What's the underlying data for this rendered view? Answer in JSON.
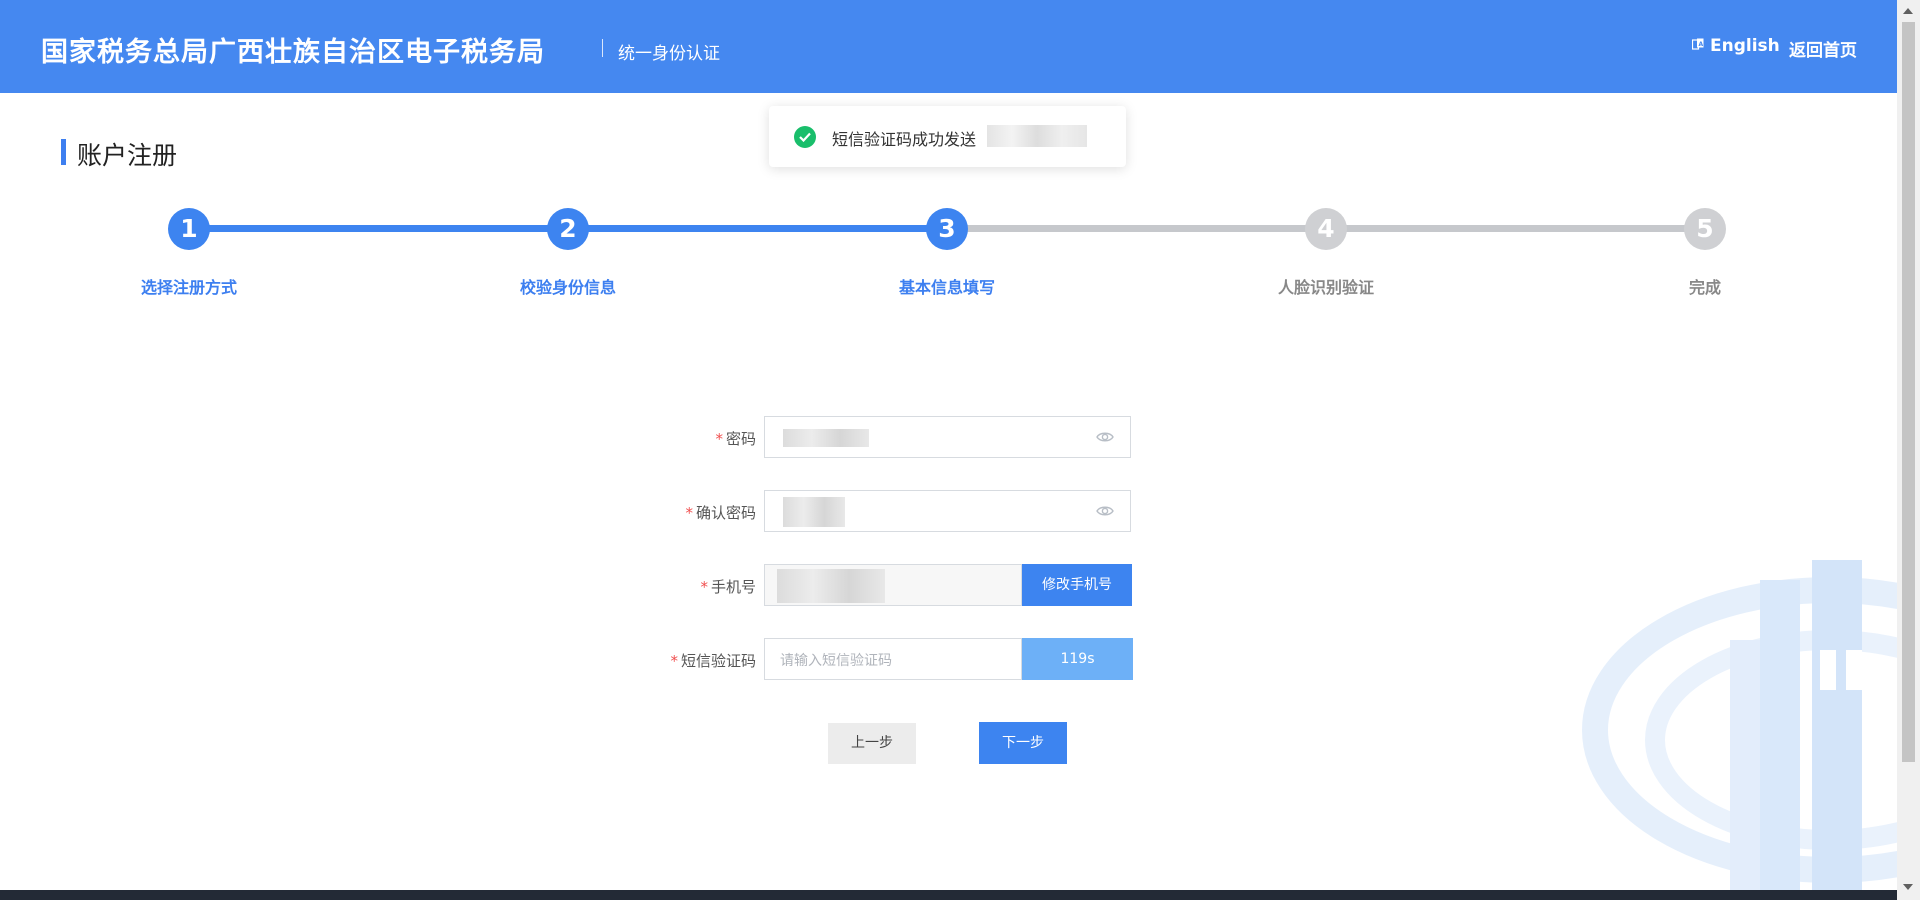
{
  "header": {
    "title": "国家税务总局广西壮族自治区电子税务局",
    "subtitle": "统一身份认证",
    "language_label": "English",
    "home_label": "返回首页"
  },
  "toast": {
    "message": "短信验证码成功发送",
    "icon": "check-circle-icon"
  },
  "page": {
    "section_title": "账户注册"
  },
  "steps": [
    {
      "number": "1",
      "label": "选择注册方式",
      "status": "done"
    },
    {
      "number": "2",
      "label": "校验身份信息",
      "status": "done"
    },
    {
      "number": "3",
      "label": "基本信息填写",
      "status": "current"
    },
    {
      "number": "4",
      "label": "人脸识别验证",
      "status": "todo"
    },
    {
      "number": "5",
      "label": "完成",
      "status": "todo"
    }
  ],
  "form": {
    "required_mark": "*",
    "password_label": "密码",
    "confirm_password_label": "确认密码",
    "phone_label": "手机号",
    "change_phone_button": "修改手机号",
    "sms_code_label": "短信验证码",
    "sms_code_placeholder": "请输入短信验证码",
    "countdown": "119s"
  },
  "actions": {
    "prev_label": "上一步",
    "next_label": "下一步"
  },
  "colors": {
    "header_bg": "#4588f0",
    "primary": "#3d84f0",
    "step_inactive": "#c6c8cc",
    "success": "#19be6b",
    "required": "#f05050"
  }
}
